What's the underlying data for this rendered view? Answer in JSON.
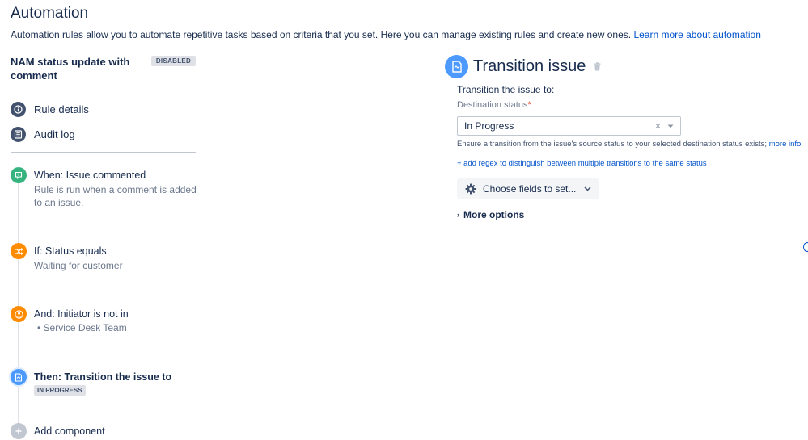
{
  "page": {
    "title": "Automation",
    "description": "Automation rules allow you to automate repetitive tasks based on criteria that you set. Here you can manage existing rules and create new ones. ",
    "learn_more": "Learn more about automation"
  },
  "rule": {
    "name": "NAM status update with comment",
    "status_badge": "DISABLED"
  },
  "nav": {
    "rule_details": "Rule details",
    "audit_log": "Audit log"
  },
  "steps": [
    {
      "title": "When: Issue commented",
      "desc": "Rule is run when a comment is added to an issue.",
      "icon": "comment-trigger-icon"
    },
    {
      "title": "If: Status equals",
      "desc": "Waiting for customer",
      "icon": "shuffle-condition-icon"
    },
    {
      "title": "And: Initiator is not in",
      "bullet": "Service Desk Team",
      "icon": "user-condition-icon"
    },
    {
      "title": "Then: Transition the issue to",
      "badge": "IN PROGRESS",
      "icon": "transition-action-icon"
    },
    {
      "title": "Add component",
      "icon": "add-icon"
    }
  ],
  "action": {
    "title": "Transition issue",
    "transition_label": "Transition the issue to:",
    "destination_label": "Destination status",
    "required_mark": "*",
    "selected_status": "In Progress",
    "help_text": "Ensure a transition from the issue's source status to your selected destination status exists; ",
    "more_info": "more info.",
    "regex_link": "+ add regex to distinguish between multiple transitions to the same status",
    "choose_fields": "Choose fields to set...",
    "more_options": "More options"
  },
  "colors": {
    "trigger": "#36b37e",
    "condition": "#ff8b00",
    "action": "#4c9aff",
    "link": "#0052cc"
  }
}
